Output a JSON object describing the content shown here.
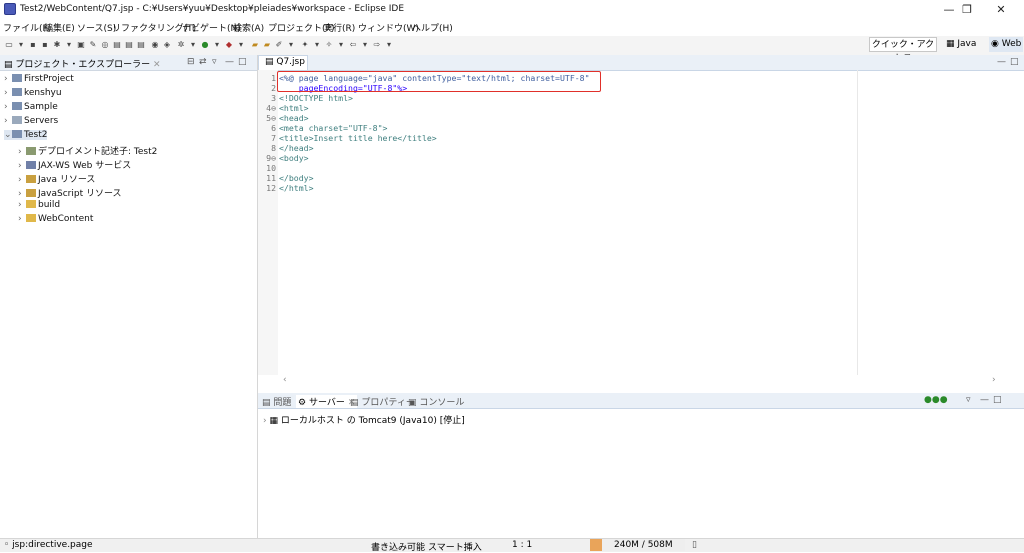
{
  "window": {
    "title": "Test2/WebContent/Q7.jsp - C:¥Users¥yuu¥Desktop¥pleiades¥workspace - Eclipse IDE"
  },
  "menu": [
    "ファイル(F)",
    "編集(E)",
    "ソース(S)",
    "リファクタリング(T)",
    "ナビゲート(N)",
    "検索(A)",
    "プロジェクト(P)",
    "実行(R)",
    "ウィンドウ(W)",
    "ヘルプ(H)"
  ],
  "toolbar": {
    "quick_access": "クイック・アクセス",
    "persp_java": "Java",
    "persp_web": "Web"
  },
  "explorer": {
    "title": "プロジェクト・エクスプローラー",
    "items": [
      {
        "label": "FirstProject"
      },
      {
        "label": "kenshyu"
      },
      {
        "label": "Sample"
      },
      {
        "label": "Servers"
      },
      {
        "label": "Test2"
      },
      {
        "label": "デプロイメント記述子: Test2"
      },
      {
        "label": "JAX-WS Web サービス"
      },
      {
        "label": "Java リソース"
      },
      {
        "label": "JavaScript リソース"
      },
      {
        "label": "build"
      },
      {
        "label": "WebContent"
      }
    ]
  },
  "editor": {
    "tab": "Q7.jsp",
    "lines": [
      {
        "n": "1",
        "text": "<%@ page language=\"java\" contentType=\"text/html; charset=UTF-8\""
      },
      {
        "n": "2",
        "text": "    pageEncoding=\"UTF-8\"%>"
      },
      {
        "n": "3",
        "text": "<!DOCTYPE html>"
      },
      {
        "n": "4⊖",
        "text": "<html>"
      },
      {
        "n": "5⊖",
        "text": "<head>"
      },
      {
        "n": "6",
        "text": "<meta charset=\"UTF-8\">"
      },
      {
        "n": "7",
        "text": "<title>Insert title here</title>"
      },
      {
        "n": "8",
        "text": "</head>"
      },
      {
        "n": "9⊖",
        "text": "<body>"
      },
      {
        "n": "10",
        "text": ""
      },
      {
        "n": "11",
        "text": "</body>"
      },
      {
        "n": "12",
        "text": "</html>"
      }
    ]
  },
  "bottom": {
    "tabs": [
      "問題",
      "サーバー",
      "プロパティー",
      "コンソール"
    ],
    "server": "ローカルホスト の Tomcat9 (Java10)  [停止]"
  },
  "status": {
    "left": "jsp:directive.page",
    "writable": "書き込み可能",
    "insert": "スマート挿入",
    "pos": "1 : 1",
    "heap": "240M / 508M"
  },
  "colors": {
    "highlight": "#e0302a",
    "tag": "#3f7f7f",
    "attr": "#7f007f",
    "value": "#2a00ff"
  }
}
